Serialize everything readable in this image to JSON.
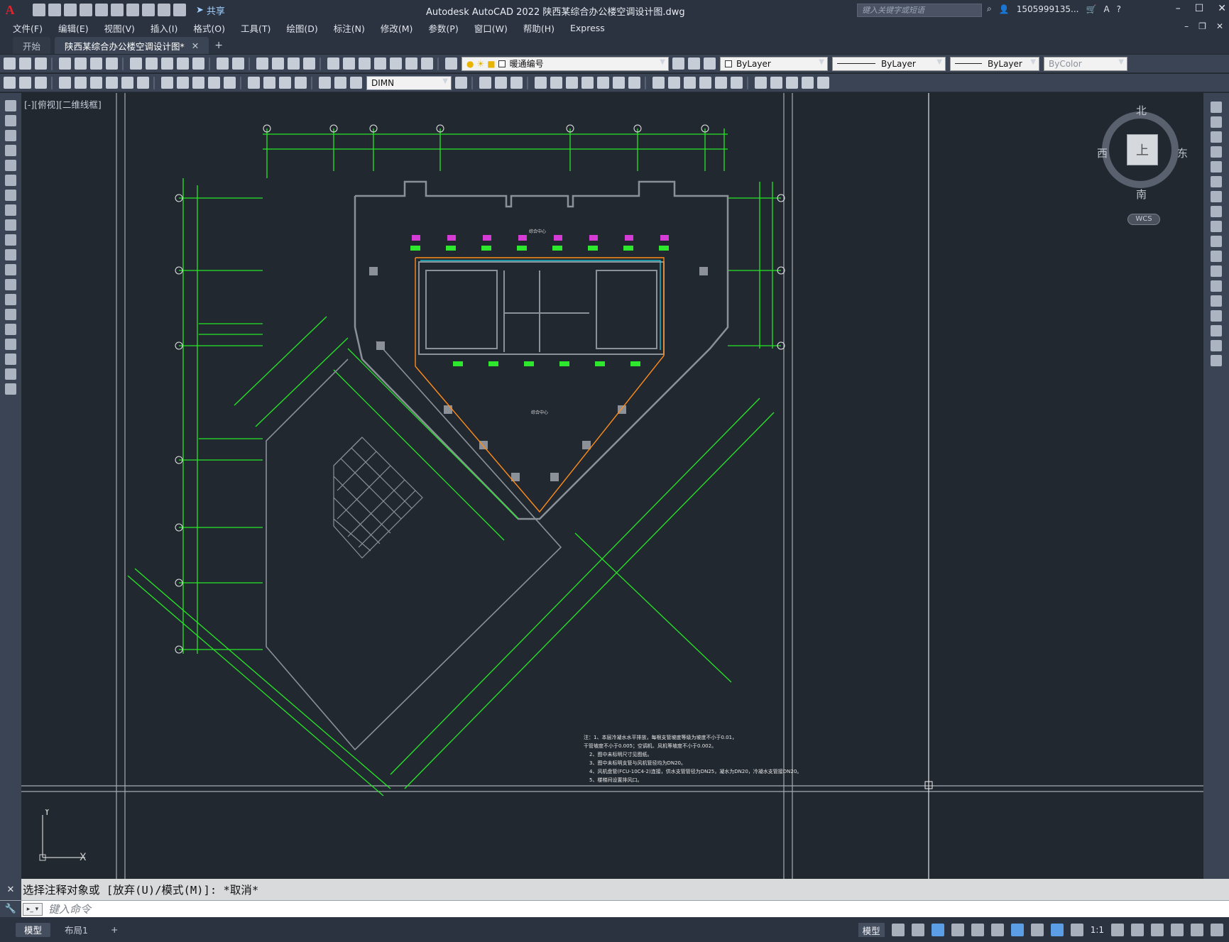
{
  "app": {
    "logo": "A",
    "title": "Autodesk AutoCAD 2022    陕西某综合办公楼空调设计图.dwg",
    "share_label": "共享",
    "search_placeholder": "键入关键字或短语",
    "user": "1505999135...",
    "help": "?"
  },
  "menu": [
    "文件(F)",
    "编辑(E)",
    "视图(V)",
    "插入(I)",
    "格式(O)",
    "工具(T)",
    "绘图(D)",
    "标注(N)",
    "修改(M)",
    "参数(P)",
    "窗口(W)",
    "帮助(H)",
    "Express"
  ],
  "tabs": {
    "start": "开始",
    "active": "陕西某综合办公楼空调设计图*"
  },
  "toolbar": {
    "layer_name": "暖通编号",
    "color": "ByLayer",
    "linetype": "ByLayer",
    "lineweight": "ByLayer",
    "plotstyle": "ByColor",
    "dimstyle": "DIMN"
  },
  "viewport": {
    "label": "[-][俯视][二维线框]"
  },
  "viewcube": {
    "north": "北",
    "south": "南",
    "east": "东",
    "west": "西",
    "face": "上",
    "wcs": "WCS"
  },
  "ucs": {
    "x": "X",
    "y": "Y"
  },
  "drawing": {
    "room_label_top": "综合中心",
    "room_label_mid": "综合中心",
    "notes": [
      "注：1、本层冷凝水水平排放，每根支管坡度等级为坡度不小于0.01，",
      "    干管坡度不小于0.005；空调机、风机等坡度不小于0.002。",
      "2、图中未标明尺寸见图纸。",
      "3、图中未标明支管与风机管径均为DN20。",
      "4、风机盘管(FCU-10C4-2)连接，供水支管管径为DN25，凝水为DN20，冷凝水支管接DN20。",
      "5、楼梯间设置排风口。"
    ]
  },
  "command": {
    "history": "选择注释对象或 [放弃(U)/模式(M)]: *取消*",
    "placeholder": "键入命令"
  },
  "status": {
    "tabs": [
      "模型",
      "布局1"
    ],
    "model_label": "模型",
    "scale": "1:1"
  }
}
